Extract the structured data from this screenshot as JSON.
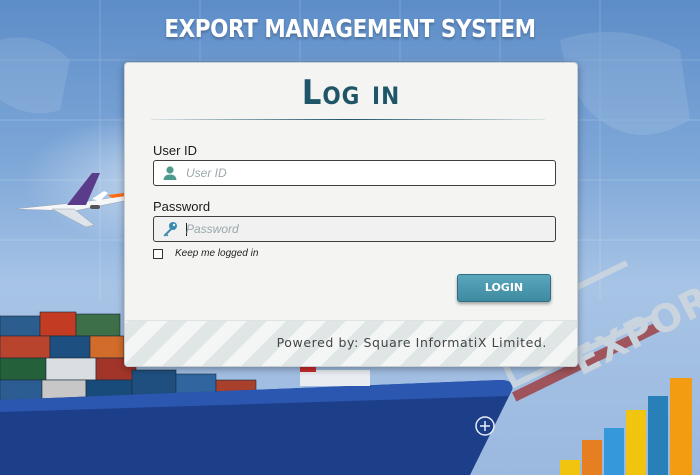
{
  "header": {
    "title": "EXPORT MANAGEMENT SYSTEM"
  },
  "login": {
    "heading": "Log in",
    "user_id": {
      "label": "User ID",
      "placeholder": "User ID",
      "value": "",
      "icon": "user-icon"
    },
    "password": {
      "label": "Password",
      "placeholder": "Password",
      "value": "",
      "icon": "key-icon"
    },
    "remember": {
      "label": "Keep me logged in",
      "checked": false
    },
    "button_label": "LOGIN"
  },
  "footer": {
    "text": "Powered by: Square InformatiX Limited."
  },
  "background": {
    "sign_text": "EXPORT"
  },
  "colors": {
    "accent": "#4597ad",
    "heading": "#1f5568",
    "sky": "#7fa8d8"
  }
}
